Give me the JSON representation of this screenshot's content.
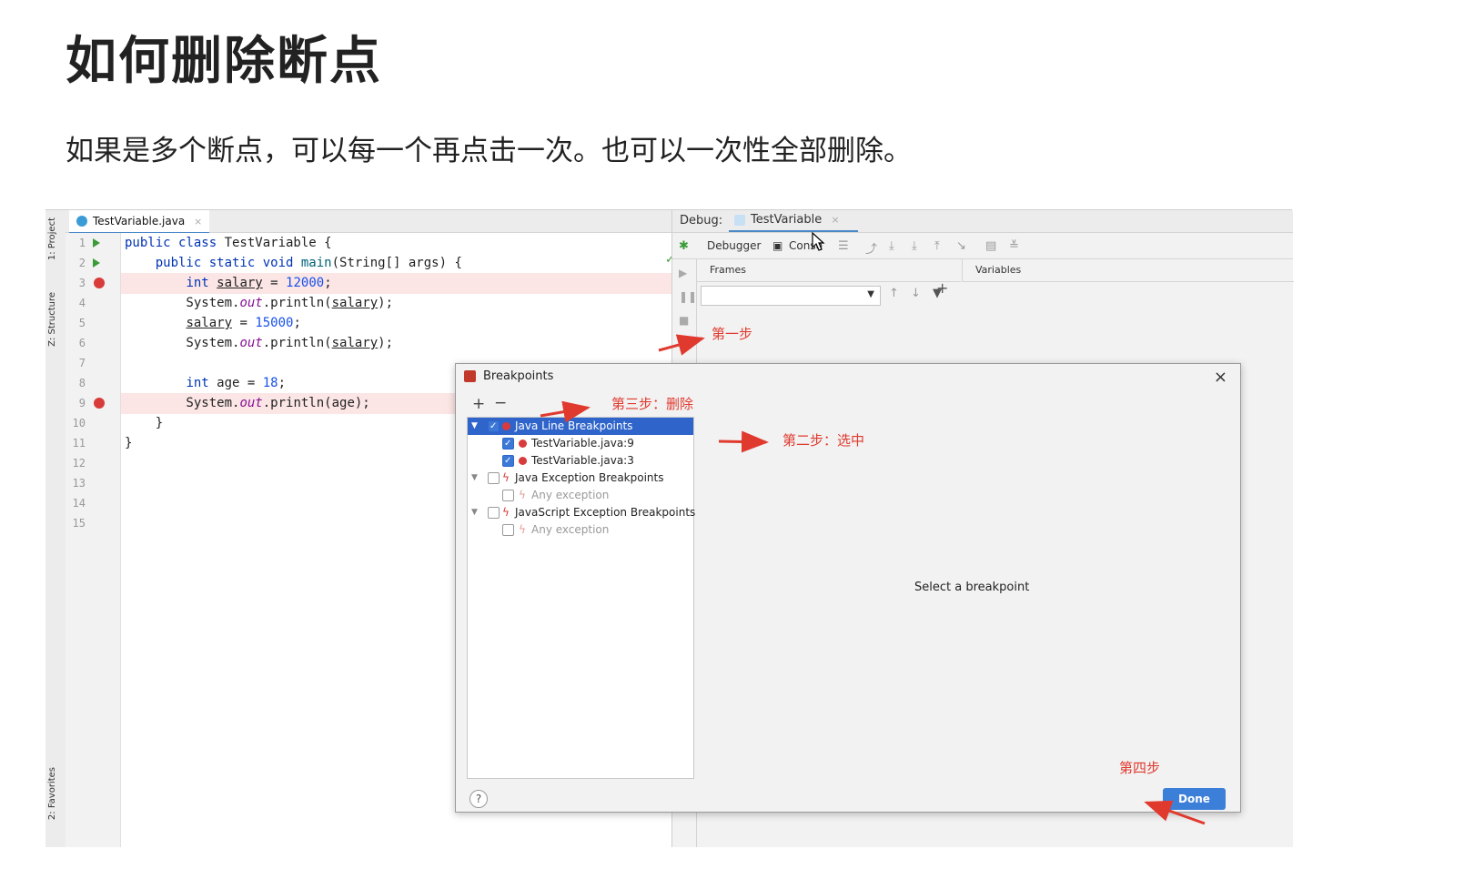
{
  "slide": {
    "title": "如何删除断点",
    "subtitle": "如果是多个断点，可以每一个再点击一次。也可以一次性全部删除。"
  },
  "left_strip": {
    "project": "1: Project",
    "structure": "Z: Structure",
    "favorites": "2: Favorites"
  },
  "editor": {
    "tab": "TestVariable.java",
    "line_numbers": [
      "1",
      "2",
      "3",
      "4",
      "5",
      "6",
      "7",
      "8",
      "9",
      "10",
      "11",
      "12",
      "13",
      "14",
      "15"
    ],
    "breakpoint_lines": [
      3,
      9
    ]
  },
  "debug": {
    "label": "Debug:",
    "session_tab": "TestVariable",
    "tabs": {
      "debugger": "Debugger",
      "console": "Conso"
    },
    "frames_header": "Frames",
    "variables_header": "Variables"
  },
  "dialog": {
    "title": "Breakpoints",
    "tree": {
      "java_line": "Java Line Breakpoints",
      "bp1": "TestVariable.java:9",
      "bp2": "TestVariable.java:3",
      "java_exc": "Java Exception Breakpoints",
      "any1": "Any exception",
      "js_exc": "JavaScript Exception Breakpoints",
      "any2": "Any exception"
    },
    "select_msg": "Select a breakpoint",
    "help": "?",
    "done": "Done"
  },
  "annotations": {
    "step1": "第一步",
    "step2": "第二步：选中",
    "step3": "第三步：删除",
    "step4": "第四步"
  },
  "colors": {
    "annotation": "#e03a2f",
    "selection": "#2f65ca",
    "breakpoint": "#d93b3b",
    "done_button": "#3c7fd8"
  }
}
